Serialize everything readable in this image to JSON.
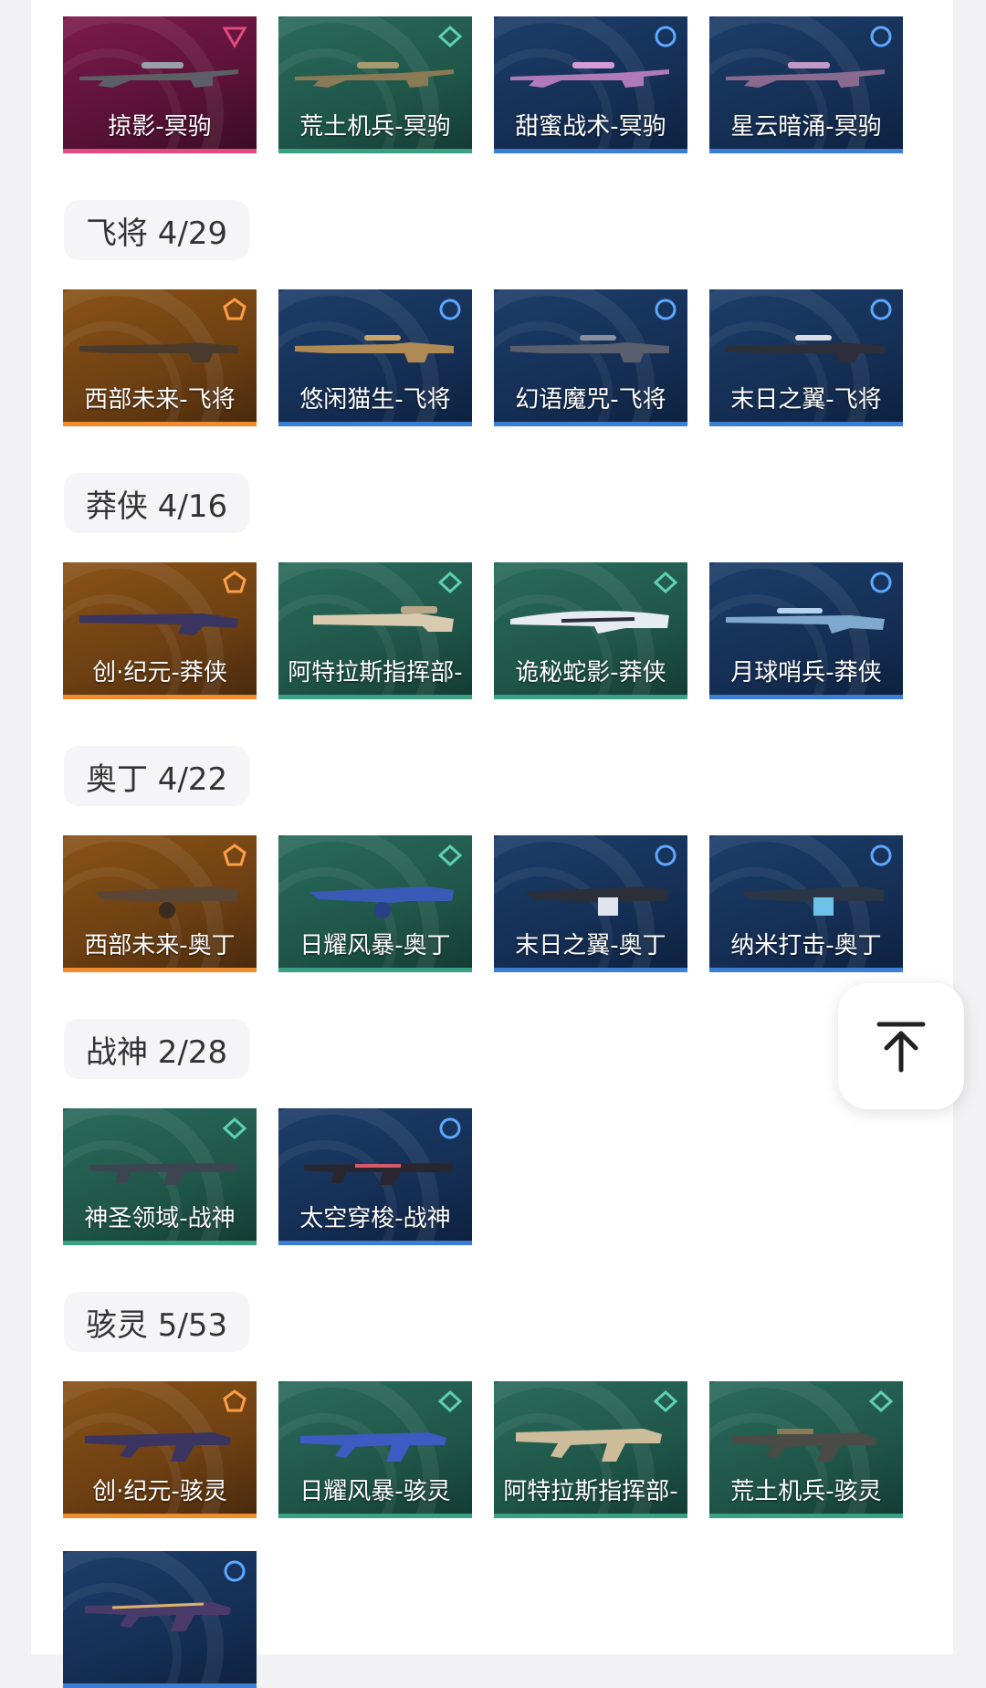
{
  "sections": [
    {
      "header": "",
      "items": [
        {
          "label": "掠影-冥驹",
          "rarity": "pink"
        },
        {
          "label": "荒土机兵-冥驹",
          "rarity": "teal"
        },
        {
          "label": "甜蜜战术-冥驹",
          "rarity": "blue"
        },
        {
          "label": "星云暗涌-冥驹",
          "rarity": "blue"
        }
      ]
    },
    {
      "header": "飞将 4/29",
      "items": [
        {
          "label": "西部未来-飞将",
          "rarity": "orange"
        },
        {
          "label": "悠闲猫生-飞将",
          "rarity": "blue"
        },
        {
          "label": "幻语魔咒-飞将",
          "rarity": "blue"
        },
        {
          "label": "末日之翼-飞将",
          "rarity": "blue"
        }
      ]
    },
    {
      "header": "莽侠 4/16",
      "items": [
        {
          "label": "创·纪元-莽侠",
          "rarity": "orange"
        },
        {
          "label": "阿特拉斯指挥部-",
          "rarity": "teal"
        },
        {
          "label": "诡秘蛇影-莽侠",
          "rarity": "teal"
        },
        {
          "label": "月球哨兵-莽侠",
          "rarity": "blue"
        }
      ]
    },
    {
      "header": "奥丁 4/22",
      "items": [
        {
          "label": "西部未来-奥丁",
          "rarity": "orange"
        },
        {
          "label": "日耀风暴-奥丁",
          "rarity": "teal"
        },
        {
          "label": "末日之翼-奥丁",
          "rarity": "blue"
        },
        {
          "label": "纳米打击-奥丁",
          "rarity": "blue"
        }
      ]
    },
    {
      "header": "战神 2/28",
      "items": [
        {
          "label": "神圣领域-战神",
          "rarity": "teal"
        },
        {
          "label": "太空穿梭-战神",
          "rarity": "blue"
        }
      ]
    },
    {
      "header": "骇灵 5/53",
      "items": [
        {
          "label": "创·纪元-骇灵",
          "rarity": "orange"
        },
        {
          "label": "日耀风暴-骇灵",
          "rarity": "teal"
        },
        {
          "label": "阿特拉斯指挥部-",
          "rarity": "teal"
        },
        {
          "label": "荒土机兵-骇灵",
          "rarity": "teal"
        },
        {
          "label": "",
          "rarity": "blue"
        }
      ]
    }
  ],
  "scroll_top_icon": "arrow-up-to-top-icon",
  "colors": {
    "pink": "#e14b82",
    "orange": "#f08c2d",
    "teal": "#3aa184",
    "blue": "#3a7fd1"
  }
}
